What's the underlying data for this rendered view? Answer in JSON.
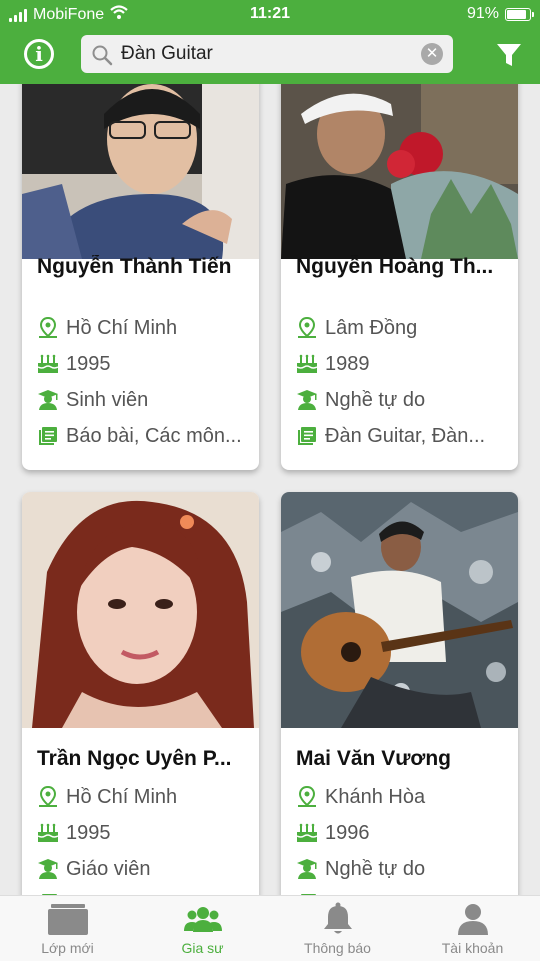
{
  "status_bar": {
    "carrier": "MobiFone",
    "time": "11:21",
    "battery": "91%"
  },
  "search": {
    "value": "Đàn Guitar"
  },
  "tutors": [
    {
      "name": "Nguyễn Thành Tiến",
      "location": "Hồ Chí Minh",
      "birth_year": "1995",
      "occupation": "Sinh viên",
      "subjects": "Báo bài, Các môn..."
    },
    {
      "name": "Nguyễn Hoàng Th...",
      "location": "Lâm Đồng",
      "birth_year": "1989",
      "occupation": "Nghề tự do",
      "subjects": "Đàn Guitar, Đàn..."
    },
    {
      "name": "Trần Ngọc Uyên P...",
      "location": "Hồ Chí Minh",
      "birth_year": "1995",
      "occupation": "Giáo viên",
      "subjects": ""
    },
    {
      "name": "Mai Văn Vương",
      "location": "Khánh Hòa",
      "birth_year": "1996",
      "occupation": "Nghề tự do",
      "subjects": ""
    }
  ],
  "tabs": [
    {
      "label": "Lớp mới",
      "icon": "class-icon"
    },
    {
      "label": "Gia sư",
      "icon": "tutors-icon",
      "active": true
    },
    {
      "label": "Thông báo",
      "icon": "bell-icon"
    },
    {
      "label": "Tài khoản",
      "icon": "account-icon"
    }
  ],
  "colors": {
    "brand_green": "#4caf3e",
    "inactive_gray": "#8a8a8a"
  }
}
